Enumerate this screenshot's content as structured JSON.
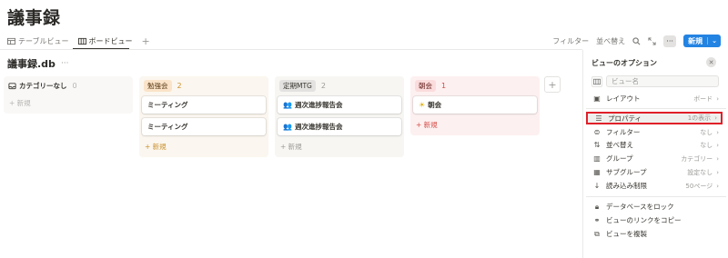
{
  "page": {
    "title": "議事録"
  },
  "tabs": [
    {
      "label": "テーブルビュー",
      "icon": "table-icon"
    },
    {
      "label": "ボードビュー",
      "icon": "board-icon",
      "active": true
    }
  ],
  "toolbar": {
    "filter": "フィルター",
    "sort": "並べ替え",
    "new_label": "新規",
    "more": "···"
  },
  "database": {
    "title": "議事録.db"
  },
  "board": {
    "new_item_label": "+ 新規",
    "columns": [
      {
        "name": "カテゴリーなし",
        "count": "0",
        "cards": []
      },
      {
        "name": "勉強会",
        "count": "2",
        "cards": [
          "ミーティング",
          "ミーティング"
        ]
      },
      {
        "name": "定期MTG",
        "count": "2",
        "cards": [
          "週次進捗報告会",
          "週次進捗報告会"
        ]
      },
      {
        "name": "朝会",
        "count": "1",
        "cards": [
          "朝会"
        ]
      }
    ]
  },
  "panel": {
    "title": "ビューのオプション",
    "name_placeholder": "ビュー名",
    "options": [
      {
        "label": "レイアウト",
        "value": "ボード",
        "icon": "layout-icon"
      },
      {
        "label": "プロパティ",
        "value": "1の表示",
        "icon": "list-icon",
        "highlighted": true
      },
      {
        "label": "フィルター",
        "value": "なし",
        "icon": "filter-icon"
      },
      {
        "label": "並べ替え",
        "value": "なし",
        "icon": "sort-icon"
      },
      {
        "label": "グループ",
        "value": "カテゴリー",
        "icon": "group-icon"
      },
      {
        "label": "サブグループ",
        "value": "設定なし",
        "icon": "subgroup-icon"
      },
      {
        "label": "読み込み制限",
        "value": "50ページ",
        "icon": "load-limit-icon"
      }
    ],
    "actions": [
      {
        "label": "データベースをロック",
        "icon": "lock-icon"
      },
      {
        "label": "ビューのリンクをコピー",
        "icon": "link-icon"
      },
      {
        "label": "ビューを複製",
        "icon": "duplicate-icon"
      }
    ]
  },
  "colors": {
    "accent": "#2383e2",
    "highlight_border": "#e0202a",
    "col_none_bg": "#f9f8f7",
    "col_study_bg": "#fbf6ef",
    "col_study_tag": "#fae3c8",
    "col_mtg_bg": "#f7f6f3",
    "col_mtg_tag": "#e3e2e0",
    "col_morning_bg": "#fdf0f0",
    "col_morning_tag": "#fbdcdc"
  }
}
